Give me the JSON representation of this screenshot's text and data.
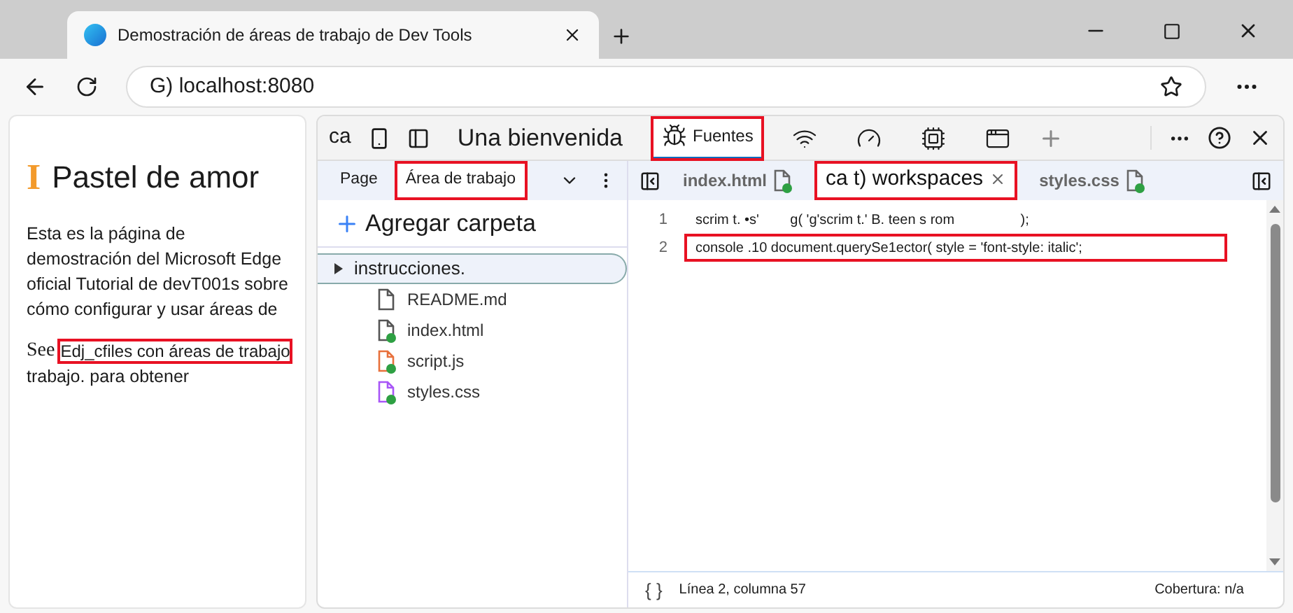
{
  "browser": {
    "tab_title": "Demostración de áreas de trabajo de Dev Tools",
    "address": "G) localhost:8080"
  },
  "page": {
    "logo": "I",
    "title": "Pastel de amor",
    "paragraph": "Esta es la página de demostración del Microsoft Edge oficial Tutorial de devT001s sobre cómo configurar y usar áreas de",
    "see": "See",
    "link": "Edj_cfiles con áreas de trabajo",
    "link_highlighted": true,
    "after": "trabajo. para obtener"
  },
  "devtools": {
    "toolbar_text": "ca",
    "tabs": [
      {
        "kind": "text",
        "label": "Una bienvenida",
        "selected": false,
        "highlighted": false
      },
      {
        "kind": "sources",
        "label": "Fuentes",
        "selected": true,
        "highlighted": true
      },
      {
        "kind": "wifi",
        "selected": false,
        "highlighted": false
      },
      {
        "kind": "gauge",
        "selected": false,
        "highlighted": false
      },
      {
        "kind": "chip",
        "selected": false,
        "highlighted": false
      },
      {
        "kind": "window",
        "selected": false,
        "highlighted": false
      }
    ],
    "navigator_tabs": [
      {
        "label": "Page",
        "selected": false,
        "highlighted": false
      },
      {
        "label": "Área de trabajo",
        "selected": true,
        "highlighted": true
      }
    ],
    "add_folder": "Agregar carpeta",
    "tree": [
      {
        "name": "instrucciones.",
        "children": [
          {
            "name": "README.md",
            "color": "#555555",
            "modified": false
          },
          {
            "name": "index.html",
            "color": "#555555",
            "modified": true
          },
          {
            "name": "script.js",
            "color": "#e8713c",
            "modified": true
          },
          {
            "name": "styles.css",
            "color": "#a855f7",
            "modified": true
          }
        ]
      }
    ],
    "editor_tabs": [
      {
        "label": "index.html",
        "selected": false,
        "highlighted": false,
        "modified": true
      },
      {
        "label": "ca t) workspaces",
        "selected": true,
        "highlighted": true,
        "modified": false
      },
      {
        "label": "styles.css",
        "selected": false,
        "highlighted": false,
        "modified": true
      }
    ],
    "code": [
      {
        "number": "1",
        "text": "scrim t. •s'        g( 'g'scrim t.' B. teen s rom                 );",
        "highlighted": false
      },
      {
        "number": "2",
        "text": "console .10 document.querySe1ector( style = 'font-style: italic';",
        "highlighted": true
      }
    ],
    "status": {
      "braces": "{ }",
      "position": "Línea 2, columna 57",
      "coverage": "Cobertura: n/a"
    }
  }
}
